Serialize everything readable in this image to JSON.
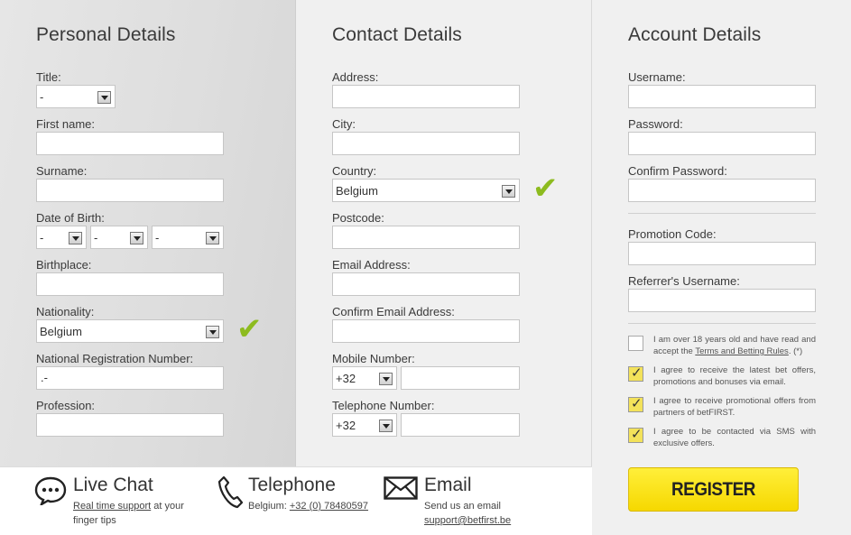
{
  "personal": {
    "heading": "Personal Details",
    "title_label": "Title:",
    "title_value": "-",
    "firstname_label": "First name:",
    "surname_label": "Surname:",
    "dob_label": "Date of Birth:",
    "dob_day": "-",
    "dob_month": "-",
    "dob_year": "-",
    "birthplace_label": "Birthplace:",
    "nationality_label": "Nationality:",
    "nationality_value": "Belgium",
    "nrn_label": "National Registration Number:",
    "nrn_value": ".-",
    "profession_label": "Profession:"
  },
  "contact": {
    "heading": "Contact Details",
    "address_label": "Address:",
    "city_label": "City:",
    "country_label": "Country:",
    "country_value": "Belgium",
    "postcode_label": "Postcode:",
    "email_label": "Email Address:",
    "confirm_email_label": "Confirm Email Address:",
    "mobile_label": "Mobile Number:",
    "mobile_prefix": "+32",
    "telephone_label": "Telephone Number:",
    "telephone_prefix": "+32"
  },
  "account": {
    "heading": "Account Details",
    "username_label": "Username:",
    "password_label": "Password:",
    "confirm_password_label": "Confirm Password:",
    "promo_label": "Promotion Code:",
    "referrer_label": "Referrer's Username:",
    "consent1_pre": "I am over 18 years old and have read and accept the",
    "consent1_link": "Terms and Betting Rules",
    "consent1_post": ". (*)",
    "consent2": "I agree to receive the latest bet offers, promotions and bonuses via email.",
    "consent3": "I agree to receive promotional offers from partners of betFIRST.",
    "consent4": "I agree to be contacted via SMS with exclusive offers.",
    "register_label": "REGISTER"
  },
  "footer": {
    "chat_title": "Live Chat",
    "chat_link": "Real time support",
    "chat_text": " at your",
    "chat_text2": "finger tips",
    "phone_title": "Telephone",
    "phone_prefix": "Belgium: ",
    "phone_number": "+32 (0) 78480597",
    "email_title": "Email",
    "email_text": "Send us an email",
    "email_address": "support@betfirst.be"
  },
  "colors": {
    "accent_yellow": "#f6d800",
    "check_green": "#8dbb1f"
  }
}
